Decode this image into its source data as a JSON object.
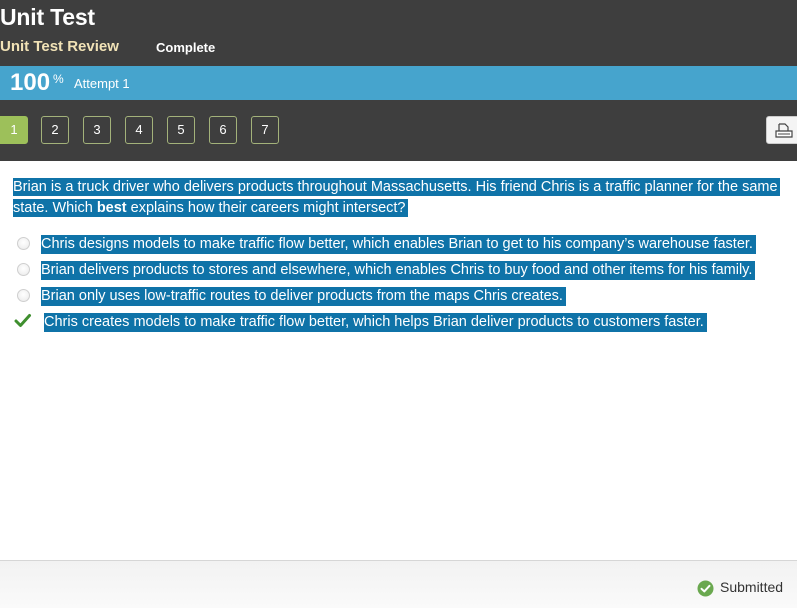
{
  "header": {
    "title": "Unit Test",
    "subtitle": "Unit Test Review",
    "status": "Complete"
  },
  "score_bar": {
    "score": "100",
    "score_unit": "%",
    "attempt": "Attempt 1"
  },
  "nav": {
    "questions": [
      {
        "label": "1",
        "active": true
      },
      {
        "label": "2",
        "active": false
      },
      {
        "label": "3",
        "active": false
      },
      {
        "label": "4",
        "active": false
      },
      {
        "label": "5",
        "active": false
      },
      {
        "label": "6",
        "active": false
      },
      {
        "label": "7",
        "active": false
      }
    ],
    "print_icon": "printer-icon"
  },
  "question": {
    "text_before": "Brian is a truck driver who delivers products throughout Massachusetts. His friend Chris is a traffic planner for the same state. Which ",
    "text_bold": "best",
    "text_after": " explains how their careers might intersect?"
  },
  "options": [
    {
      "text": "Chris designs models to make traffic flow better, which enables Brian to get to his company’s warehouse faster.",
      "state": "unselected"
    },
    {
      "text": "Brian delivers products to stores and elsewhere, which enables Chris to buy food and other items for his family.",
      "state": "unselected"
    },
    {
      "text": "Brian only uses low-traffic routes to deliver products from the maps Chris creates.",
      "state": "unselected"
    },
    {
      "text": "Chris creates models to make traffic flow better, which helps Brian deliver products to customers faster.",
      "state": "correct-selected"
    }
  ],
  "footer": {
    "status_label": "Submitted",
    "status_color": "#6aa84f"
  },
  "colors": {
    "header_bg": "#3e3e3e",
    "score_bar_bg": "#46a4cd",
    "active_question": "#9dc05a",
    "highlight": "#0f73a8",
    "check": "#3f8f2f"
  }
}
